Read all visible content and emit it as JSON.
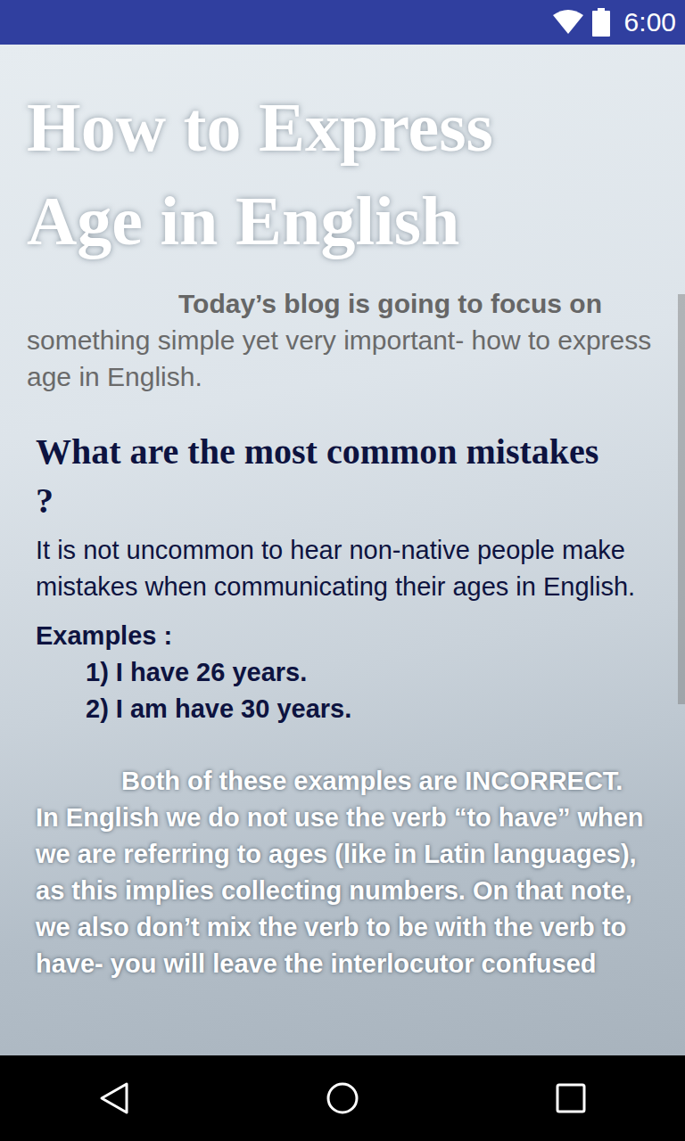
{
  "status_bar": {
    "time": "6:00"
  },
  "article": {
    "title": "How to Express Age in English",
    "intro": {
      "lead": "Today’s blog is going to focus on ",
      "rest": "something simple yet very important- how to express age in English."
    },
    "section": {
      "heading": "What are the most common mistakes ?",
      "paragraph": "It is not uncommon to hear non-native people make mistakes when communicating their ages in English.",
      "examples_label": "Examples :",
      "examples": [
        "1) I have 26 years.",
        "2) I am have 30 years."
      ],
      "explanation": "Both of these examples are INCORRECT. In English we do not use the verb “to have” when we are referring to ages (like in Latin languages), as this implies collecting numbers. On that note, we also don’t mix the verb to be with the verb to have- you will leave the interlocutor confused"
    }
  }
}
